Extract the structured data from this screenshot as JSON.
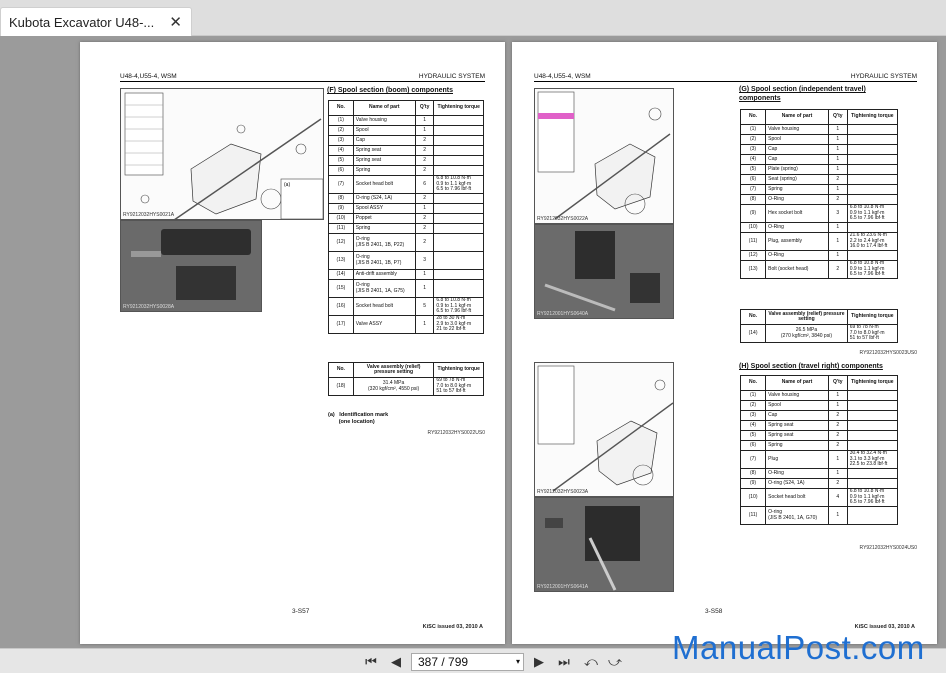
{
  "tab": {
    "title": "Kubota Excavator U48-...",
    "close": "✕"
  },
  "header": {
    "left": "U48-4,U55-4, WSM",
    "right": "HYDRAULIC SYSTEM"
  },
  "p1": {
    "fig1_caption": "RY9212032HYS0021A",
    "fig2_caption": "RY9212032HYS0028A",
    "section": "(F) Spool section (boom) components",
    "cols": [
      "No.",
      "Name of part",
      "Q'ty",
      "Tightening torque"
    ],
    "rows": [
      [
        "(1)",
        "Valve housing",
        "1",
        ""
      ],
      [
        "(2)",
        "Spool",
        "1",
        ""
      ],
      [
        "(3)",
        "Cap",
        "2",
        ""
      ],
      [
        "(4)",
        "Spring seat",
        "2",
        ""
      ],
      [
        "(5)",
        "Spring seat",
        "2",
        ""
      ],
      [
        "(6)",
        "Spring",
        "2",
        ""
      ],
      [
        "(7)",
        "Socket head bolt",
        "6",
        "6.8 to 10.8 N·m\n0.9 to 1.1 kgf·m\n6.5 to 7.96 lbf·ft"
      ],
      [
        "(8)",
        "O-ring (S24, 1A)",
        "2",
        ""
      ],
      [
        "(9)",
        "Spool ASSY",
        "1",
        ""
      ],
      [
        "(10)",
        "Poppet",
        "2",
        ""
      ],
      [
        "(11)",
        "Spring",
        "2",
        ""
      ],
      [
        "(12)",
        "O-ring\n(JIS B 2401, 1B, P22)",
        "2",
        ""
      ],
      [
        "(13)",
        "O-ring\n(JIS B 2401, 1B, P7)",
        "3",
        ""
      ],
      [
        "(14)",
        "Anti-drift assembly",
        "1",
        ""
      ],
      [
        "(15)",
        "O-ring\n(JIS B 2401, 1A, G75)",
        "1",
        ""
      ],
      [
        "(16)",
        "Socket head bolt",
        "5",
        "6.8 to 10.8 N·m\n0.9 to 1.1 kgf·m\n6.5 to 7.96 lbf·ft"
      ],
      [
        "(17)",
        "Valve ASSY",
        "1",
        "28 to 30 N·m\n2.9 to 3.0 kgf·m\n21 to 22 lbf·ft"
      ]
    ],
    "relief_cols": [
      "No.",
      "Valve assembly (relief) pressure setting",
      "Tightening torque"
    ],
    "relief_rows": [
      [
        "(18)",
        "31.4 MPa\n(320 kgf/cm², 4550 psi)",
        "69 to 78 N·m\n7.0 to 8.0 kgf·m\n51 to 57 lbf·ft"
      ]
    ],
    "note": "(a)   Identification mark\n       (one location)",
    "ref": "RY9212032HYS0022US0",
    "page_no": "3-S57",
    "footer": "KiSC issued 03, 2010 A"
  },
  "p2": {
    "fig1_caption": "RY9212032HYS0022A",
    "fig2_caption": "RY9212001HYS0640A",
    "fig3_caption": "RY9212032HYS0023A",
    "fig4_caption": "RY9212001HYS0641A",
    "sectionG": "(G) Spool section (independent travel) components",
    "colsG": [
      "No.",
      "Name of part",
      "Q'ty",
      "Tightening torque"
    ],
    "rowsG": [
      [
        "(1)",
        "Valve housing",
        "1",
        ""
      ],
      [
        "(2)",
        "Spool",
        "1",
        ""
      ],
      [
        "(3)",
        "Cap",
        "1",
        ""
      ],
      [
        "(4)",
        "Cap",
        "1",
        ""
      ],
      [
        "(5)",
        "Plate (spring)",
        "1",
        ""
      ],
      [
        "(6)",
        "Seat (spring)",
        "2",
        ""
      ],
      [
        "(7)",
        "Spring",
        "1",
        ""
      ],
      [
        "(8)",
        "O-Ring",
        "2",
        ""
      ],
      [
        "(9)",
        "Hex socket bolt",
        "3",
        "6.8 to 10.8 N·m\n0.9 to 1.1 kgf·m\n6.5 to 7.96 lbf·ft"
      ],
      [
        "(10)",
        "O-Ring",
        "1",
        ""
      ],
      [
        "(11)",
        "Plug, assembly",
        "1",
        "21.6 to 23.6 N·m\n2.2 to 2.4 kgf·m\n16.0 to 17.4 lbf·ft"
      ],
      [
        "(12)",
        "O-Ring",
        "1",
        ""
      ],
      [
        "(13)",
        "Bolt (socket head)",
        "2",
        "6.8 to 10.8 N·m\n0.9 to 1.1 kgf·m\n6.5 to 7.96 lbf·ft"
      ]
    ],
    "reliefG_cols": [
      "No.",
      "Valve assembly (relief) pressure setting",
      "Tightening torque"
    ],
    "reliefG_rows": [
      [
        "(14)",
        "26.5 MPa\n(270 kgf/cm², 3840 psi)",
        "69 to 78 N·m\n7.0 to 8.0 kgf·m\n51 to 57 lbf·ft"
      ]
    ],
    "refG": "RY9212032HYS0023US0",
    "sectionH": "(H) Spool section (travel right) components",
    "colsH": [
      "No.",
      "Name of part",
      "Q'ty",
      "Tightening torque"
    ],
    "rowsH": [
      [
        "(1)",
        "Valve housing",
        "1",
        ""
      ],
      [
        "(2)",
        "Spool",
        "1",
        ""
      ],
      [
        "(3)",
        "Cap",
        "2",
        ""
      ],
      [
        "(4)",
        "Spring seat",
        "2",
        ""
      ],
      [
        "(5)",
        "Spring seat",
        "2",
        ""
      ],
      [
        "(6)",
        "Spring",
        "2",
        ""
      ],
      [
        "(7)",
        "Plug",
        "1",
        "30.4 to 32.4 N·m\n3.1 to 3.3 kgf·m\n22.5 to 23.8 lbf·ft"
      ],
      [
        "(8)",
        "O-Ring",
        "1",
        ""
      ],
      [
        "(9)",
        "O-ring (S24, 1A)",
        "2",
        ""
      ],
      [
        "(10)",
        "Socket head bolt",
        "4",
        "6.8 to 10.8 N·m\n0.9 to 1.1 kgf·m\n6.5 to 7.96 lbf·ft"
      ],
      [
        "(11)",
        "O-ring\n(JIS B 2401, 1A, G70)",
        "1",
        ""
      ]
    ],
    "refH": "RY9212032HYS0024US0",
    "page_no": "3-S58",
    "footer": "KiSC issued 03, 2010 A"
  },
  "toolbar": {
    "first": "⏮",
    "prev": "◀",
    "page": "387 / 799",
    "dropdown": "▾",
    "next": "▶",
    "last": "⏭",
    "back": "⤺",
    "forward": "⤻"
  },
  "watermark": "ManualPost.com"
}
